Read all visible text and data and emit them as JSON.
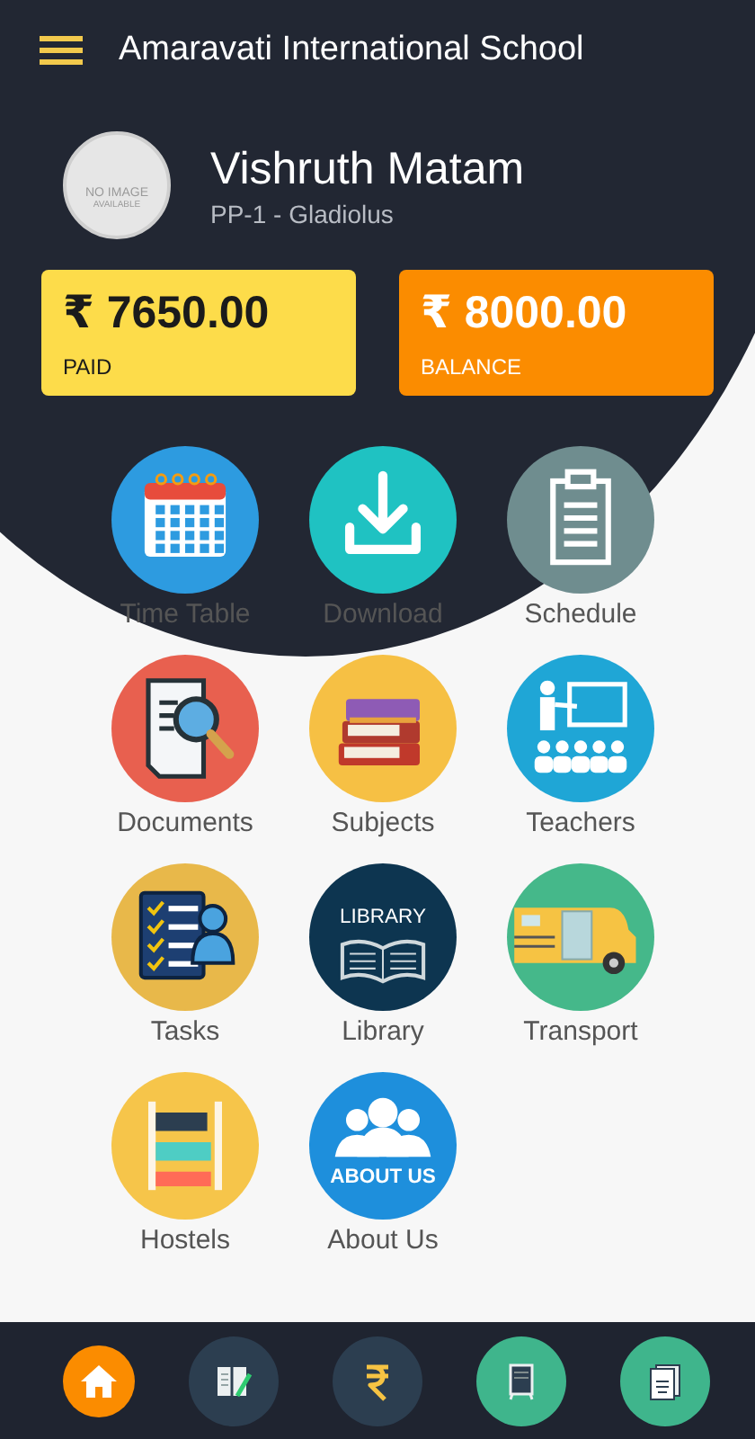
{
  "app_bar": {
    "title": "Amaravati International School"
  },
  "student": {
    "name": "Vishruth Matam",
    "class": "PP-1 - Gladiolus",
    "avatar_text": [
      "NO IMAGE",
      "AVAILABLE"
    ]
  },
  "fees": [
    {
      "kind": "paid",
      "amount": "₹ 7650.00",
      "label": "PAID"
    },
    {
      "kind": "balance",
      "amount": "₹ 8000.00",
      "label": "BALANCE"
    }
  ],
  "menu": [
    {
      "kind": "calendar",
      "label": "Time Table"
    },
    {
      "kind": "download",
      "label": "Download"
    },
    {
      "kind": "clipboard",
      "label": "Schedule"
    },
    {
      "kind": "documents",
      "label": "Documents"
    },
    {
      "kind": "books",
      "label": "Subjects"
    },
    {
      "kind": "teacher",
      "label": "Teachers"
    },
    {
      "kind": "tasks",
      "label": "Tasks"
    },
    {
      "kind": "library",
      "label": "Library",
      "icon_text": "LIBRARY"
    },
    {
      "kind": "bus",
      "label": "Transport"
    },
    {
      "kind": "shelves",
      "label": "Hostels"
    },
    {
      "kind": "people",
      "label": "About Us",
      "icon_text": "ABOUT US"
    }
  ],
  "bottom_nav": [
    {
      "kind": "home",
      "selected": true
    },
    {
      "kind": "notebook",
      "selected": false
    },
    {
      "kind": "rupee",
      "selected": false
    },
    {
      "kind": "board",
      "selected": false
    },
    {
      "kind": "document",
      "selected": false
    }
  ]
}
